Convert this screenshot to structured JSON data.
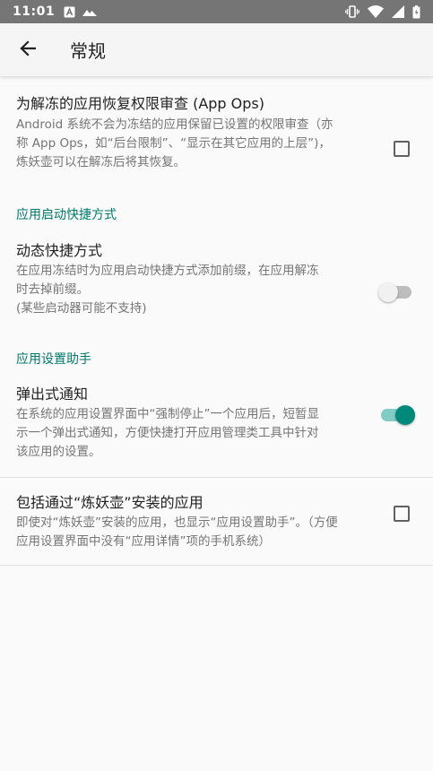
{
  "status_bar": {
    "time": "11:01",
    "left_icons": [
      "font-a-icon",
      "photo-icon"
    ],
    "right_icons": [
      "vibrate-icon",
      "wifi-icon",
      "signal-icon",
      "battery-icon"
    ]
  },
  "app_bar": {
    "back_icon": "arrow-back-icon",
    "title": "常规"
  },
  "prefs": {
    "restore_permissions": {
      "title": "为解冻的应用恢复权限审查 (App Ops)",
      "summary_lines": [
        "Android 系统不会为冻结的应用保留已设置的权限审查（亦",
        "称 App Ops，如“后台限制”、“显示在其它应用的上层”)，",
        "炼妖壶可以在解冻后将其恢复。"
      ],
      "checked": false
    },
    "launch_category": "应用启动快捷方式",
    "dynamic_shortcut": {
      "title": "动态快捷方式",
      "summary_lines": [
        "在应用冻结时为应用启动快捷方式添加前缀，在应用解冻",
        "时去掉前缀。",
        "(某些启动器可能不支持)"
      ],
      "enabled": false
    },
    "settings_category": "应用设置助手",
    "popup_notification": {
      "title": "弹出式通知",
      "summary_lines": [
        "在系统的应用设置界面中“强制停止”一个应用后，短暂显",
        "示一个弹出式通知，方便快捷打开应用管理类工具中针对",
        "该应用的设置。"
      ],
      "enabled": true
    },
    "include_installed": {
      "title": "包括通过“炼妖壶”安装的应用",
      "summary_lines": [
        "即使对“炼妖壶”安装的应用，也显示“应用设置助手”。（方便",
        "应用设置界面中没有“应用详情”项的手机系统）"
      ],
      "checked": false
    }
  },
  "colors": {
    "accent": "#00796b",
    "switch_on_thumb": "#00897b",
    "switch_on_track": "#80cbc4",
    "status_bar": "#757575"
  }
}
